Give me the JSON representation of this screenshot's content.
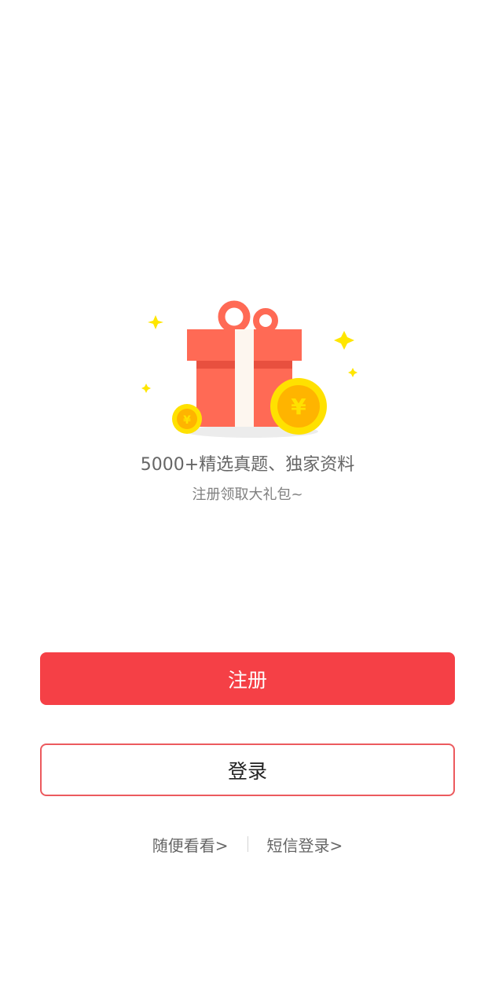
{
  "promo": {
    "headline": "5000+精选真题、独家资料",
    "subline": "注册领取大礼包~",
    "illustration": "gift-box-with-coins",
    "coin_symbol": "¥",
    "colors": {
      "gift": "#ff6a55",
      "ribbon": "#fdf6ef",
      "coin": "#ffe100",
      "sparkle": "#ffe600"
    }
  },
  "actions": {
    "register_label": "注册",
    "login_label": "登录",
    "browse_label": "随便看看>",
    "sms_login_label": "短信登录>"
  },
  "theme": {
    "primary": "#f54046",
    "outline": "#ec5a5e"
  }
}
